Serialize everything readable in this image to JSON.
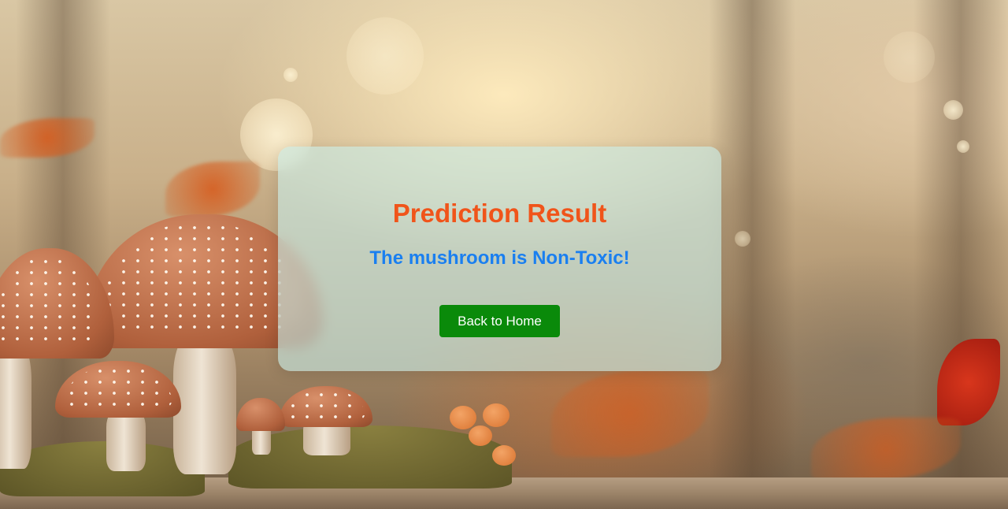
{
  "result_card": {
    "title": "Prediction Result",
    "message": "The mushroom is Non-Toxic!",
    "back_button_label": "Back to Home"
  },
  "colors": {
    "title": "#f0541a",
    "message": "#1a7ff0",
    "button_bg": "#0a8a0a",
    "button_text": "#ffffff"
  },
  "background": {
    "description_icon": "mushroom-forest-photo"
  }
}
